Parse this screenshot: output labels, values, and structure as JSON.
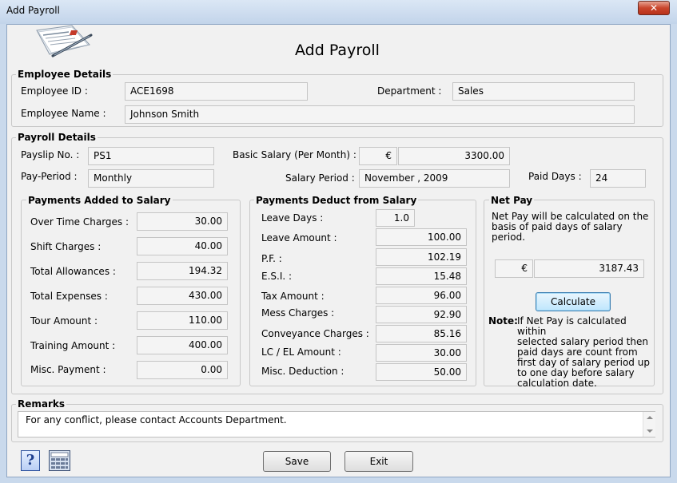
{
  "window": {
    "title": "Add Payroll",
    "close_glyph": "✕"
  },
  "header": {
    "title": "Add Payroll",
    "logo_icon": "payroll-document-pen-icon"
  },
  "employee": {
    "section": "Employee Details",
    "id_label": "Employee ID :",
    "id_value": "ACE1698",
    "dept_label": "Department :",
    "dept_value": "Sales",
    "name_label": "Employee Name :",
    "name_value": "Johnson Smith"
  },
  "payroll": {
    "section": "Payroll Details",
    "payslip_label": "Payslip No. :",
    "payslip_value": "PS1",
    "basic_label": "Basic Salary (Per Month) :",
    "currency": "€",
    "basic_value": "3300.00",
    "period_label": "Pay-Period :",
    "period_value": "Monthly",
    "salary_period_label": "Salary Period :",
    "salary_period_value": "November , 2009",
    "paid_days_label": "Paid Days :",
    "paid_days_value": "24"
  },
  "added": {
    "section": "Payments Added to Salary",
    "rows": [
      {
        "label": "Over Time Charges :",
        "value": "30.00"
      },
      {
        "label": "Shift Charges :",
        "value": "40.00"
      },
      {
        "label": "Total Allowances :",
        "value": "194.32"
      },
      {
        "label": "Total Expenses :",
        "value": "430.00"
      },
      {
        "label": "Tour Amount :",
        "value": "110.00"
      },
      {
        "label": "Training Amount :",
        "value": "400.00"
      },
      {
        "label": "Misc. Payment :",
        "value": "0.00"
      }
    ]
  },
  "deduct": {
    "section": "Payments Deduct from Salary",
    "rows": [
      {
        "label": "Leave Days :",
        "value": "1.0"
      },
      {
        "label": "Leave Amount :",
        "value": "100.00"
      },
      {
        "label": "P.F. :",
        "value": "102.19"
      },
      {
        "label": "E.S.I. :",
        "value": "15.48"
      },
      {
        "label": "Tax Amount :",
        "value": "96.00"
      },
      {
        "label": "Mess Charges :",
        "value": "92.90"
      },
      {
        "label": "Conveyance Charges :",
        "value": "85.16"
      },
      {
        "label": "LC / EL Amount :",
        "value": "30.00"
      },
      {
        "label": "Misc. Deduction :",
        "value": "50.00"
      }
    ]
  },
  "netpay": {
    "section": "Net Pay",
    "desc_lines": [
      "Net Pay will be calculated on the",
      "basis of paid days of salary",
      "period."
    ],
    "currency": "€",
    "value": "3187.43",
    "calculate_label": "Calculate",
    "note_label": "Note:",
    "note_lines": [
      "If Net Pay is calculated within",
      "selected salary period then",
      "paid days are count from",
      "first day of salary period up",
      "to one day before salary",
      "calculation date."
    ]
  },
  "remarks": {
    "section": "Remarks",
    "value": "For any conflict, please contact Accounts Department."
  },
  "footer": {
    "save_label": "Save",
    "exit_label": "Exit",
    "help_glyph": "?",
    "help_icon": "help-icon",
    "calculator_icon": "calculator-icon"
  }
}
